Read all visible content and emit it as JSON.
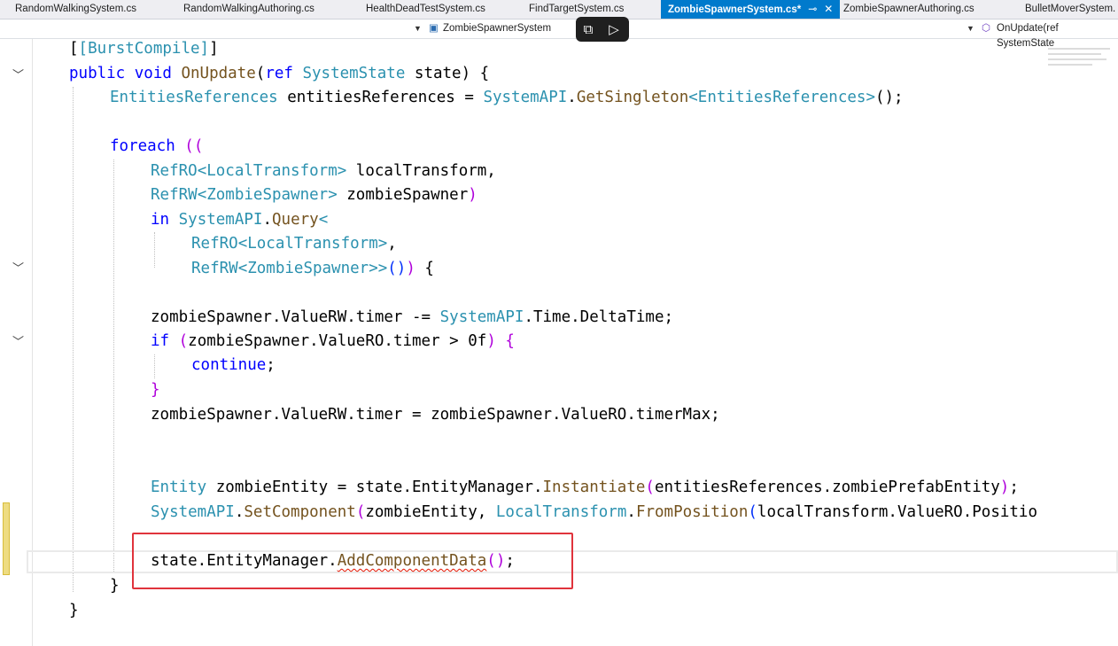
{
  "tabs": [
    {
      "label": "RandomWalkingSystem.cs"
    },
    {
      "label": "RandomWalkingAuthoring.cs"
    },
    {
      "label": "HealthDeadTestSystem.cs"
    },
    {
      "label": "FindTargetSystem.cs"
    },
    {
      "label": "ZombieSpawnerSystem.cs*",
      "active": true
    },
    {
      "label": "ZombieSpawnerAuthoring.cs"
    },
    {
      "label": "BulletMoverSystem."
    }
  ],
  "tab_pin_icon": "pin-icon",
  "tab_close_icon": "close-icon",
  "nav": {
    "type_selector": "ZombieSpawnerSystem",
    "member_selector": "OnUpdate(ref SystemState"
  },
  "colors": {
    "active_tab": "#007acc",
    "keyword": "#0000ff",
    "type": "#2b91af",
    "method": "#74531f",
    "highlight_box": "#e0333c"
  },
  "code": {
    "l1": {
      "t1": "[BurstCompile]"
    },
    "l2": {
      "k1": "public",
      "k2": "void",
      "m1": "OnUpdate",
      "p1": "(",
      "k3": "ref",
      "t1": "SystemState",
      "p2": " state) {"
    },
    "l3": {
      "t1": "EntitiesReferences",
      "p1": " entitiesReferences = ",
      "t2": "SystemAPI",
      "p2": ".",
      "m1": "GetSingleton",
      "t3": "<EntitiesReferences>",
      "p3": "();"
    },
    "l4": {
      "k1": "foreach",
      "b1": " (("
    },
    "l5": {
      "t1": "RefRO",
      "t2": "<LocalTransform>",
      "p1": " localTransform,"
    },
    "l6": {
      "t1": "RefRW",
      "t2": "<ZombieSpawner>",
      "p1": " zombieSpawner",
      "b1": ")"
    },
    "l7": {
      "k1": "in",
      "t1": "SystemAPI",
      "p1": ".",
      "m1": "Query",
      "t2": "<"
    },
    "l8": {
      "t1": "RefRO",
      "t2": "<LocalTransform>",
      "p1": ","
    },
    "l9": {
      "t1": "RefRW",
      "t2": "<ZombieSpawner>>",
      "b1": "()",
      "b2": ")",
      "p1": " {"
    },
    "l10": {
      "p1": "zombieSpawner.ValueRW.timer -= ",
      "t1": "SystemAPI",
      "p2": ".Time.DeltaTime;"
    },
    "l11": {
      "k1": "if",
      "b1": " (",
      "p1": "zombieSpawner.ValueRO.timer > ",
      "n1": "0f",
      "b2": ")",
      "p2": " ",
      "b3": "{"
    },
    "l12": {
      "k1": "continue",
      "p1": ";"
    },
    "l13": {
      "b1": "}"
    },
    "l14": {
      "p1": "zombieSpawner.ValueRW.timer = zombieSpawner.ValueRO.timerMax;"
    },
    "l15": {
      "t1": "Entity",
      "p1": " zombieEntity = state.EntityManager.",
      "m1": "Instantiate",
      "b1": "(",
      "p2": "entitiesReferences.zombiePrefabEntity",
      "b2": ")",
      "p3": ";"
    },
    "l16": {
      "t1": "SystemAPI",
      "p1": ".",
      "m1": "SetComponent",
      "b1": "(",
      "p2": "zombieEntity, ",
      "t2": "LocalTransform",
      "p3": ".",
      "m2": "FromPosition",
      "b2": "(",
      "p4": "localTransform.ValueRO.Positio"
    },
    "l17": {
      "p1": "state.EntityManager.",
      "m1": "AddComponentData",
      "b1": "()",
      "p2": ";"
    },
    "l18": {
      "p1": "}"
    },
    "l19": {
      "p1": "}"
    }
  }
}
